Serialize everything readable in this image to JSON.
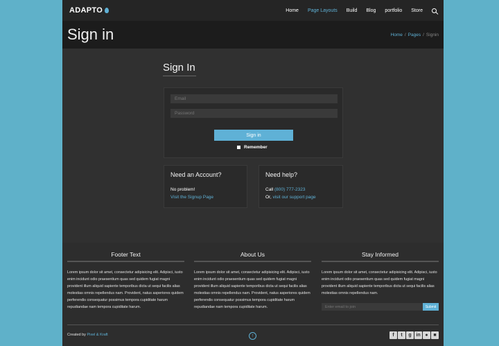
{
  "header": {
    "logo": "ADAPTO",
    "nav": [
      "Home",
      "Page Layouts",
      "Build",
      "Blog",
      "portfolio",
      "Store"
    ],
    "active_nav": "Page Layouts"
  },
  "title_bar": {
    "title": "Sign in",
    "breadcrumb": [
      "Home",
      "/",
      "Pages",
      "/",
      "Signin"
    ]
  },
  "signin": {
    "heading": "Sign In",
    "email_placeholder": "Email",
    "password_placeholder": "Password",
    "button": "Sign in",
    "remember": "Remember"
  },
  "account_card": {
    "title": "Need an Account?",
    "line1": "No problem!",
    "link": "Visit the Signup Page"
  },
  "help_card": {
    "title": "Need help?",
    "call_prefix": "Call",
    "phone": "(800) 777-2323",
    "or_prefix": "Or,",
    "link": "visit our support page"
  },
  "footer": {
    "col1_title": "Footer Text",
    "col1_text": "Lorem ipsum dolor sit amet, consectetur adipisicing elit. Adipisci, iusto enim incidunt odio praesentium quas sed quidem fugiat magni provident illum aliquid sapiente temporibus dicta ut sequi facilis alias molestias omnis repellendus nam. Provident, natus asperiores quidem perferendis consequatur possimus tempora cupiditate harum repudiandae nam tempora cupiditate harum.",
    "col2_title": "About Us",
    "col2_text": "Lorem ipsum dolor sit amet, consectetur adipisicing elit. Adipisci, iusto enim incidunt odio praesentium quas sed quidem fugiat magni provident illum aliquid sapiente temporibus dicta ut sequi facilis alias molestias omnis repellendus nam. Provident, natus asperiores quidem perferendis consequatur possimus tempora cupiditate harum repudiandae nam tempora cupiditate harum.",
    "col3_title": "Stay Informed",
    "col3_text": "Lorem ipsum dolor sit amet, consectetur adipisicing elit. Adipisci, iusto enim incidunt odio praesentium quas sed quidem fugiat magni provident illum aliquid sapiente temporibus dicta ut sequi facilis alias molestias omnis repellendus nam.",
    "email_placeholder": "Enter email to join",
    "submit": "Submit",
    "credit_prefix": "Created by",
    "credit_link": "Pixel & Kraft"
  },
  "socials": [
    "facebook-icon",
    "twitter-icon",
    "google-plus-icon",
    "linkedin-icon",
    "dribbble-icon",
    "other-icon"
  ],
  "colors": {
    "accent": "#5fb1d6",
    "page_bg": "#5fb1c9",
    "panel": "#303030"
  }
}
